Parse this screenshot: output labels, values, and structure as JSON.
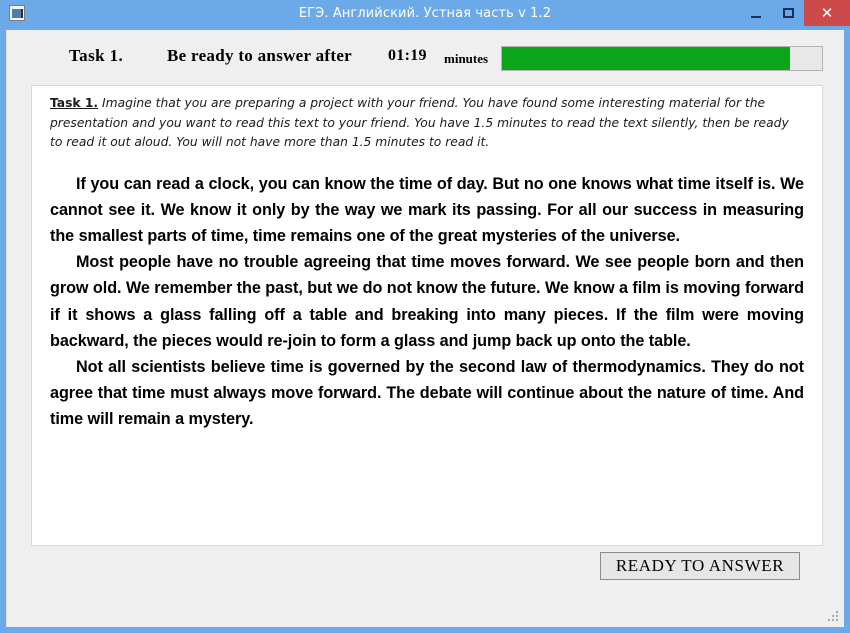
{
  "window": {
    "title": "ЕГЭ. Английский. Устная часть v 1.2",
    "app_icon": "application-window-icon",
    "controls": {
      "minimize": "minimize-icon",
      "maximize": "maximize-icon",
      "close": "✕"
    },
    "frame_color": "#6ca9e8",
    "close_color": "#cc4a49"
  },
  "toolbar": {
    "task_label": "Task 1.",
    "prompt": "Be ready to answer after",
    "timer": "01:19",
    "units": "minutes",
    "progress": {
      "percent": 90,
      "fill_color": "#0ba51c",
      "track_color": "#e8e8e8"
    }
  },
  "document": {
    "instruction_lead": "Task 1.",
    "instruction_body": " Imagine that you are preparing a project with your friend. You have found some interesting material for the presentation and you want to read this text to your friend. You have 1.5 minutes to read the text silently, then be ready to read it out aloud. You will not have more than 1.5 minutes to read it.",
    "paragraphs": [
      "If you can read a clock, you can know the time of day. But no one knows what time itself is. We cannot see it. We know it only by the way we mark its passing. For all our success in measuring the smallest parts of time, time remains one of the great mysteries of the universe.",
      "Most people have no trouble agreeing that time moves forward. We see people born and then grow old. We remember the past, but we do not know the future. We know a film is moving forward if it shows a glass falling off a table and breaking into many pieces. If the film were moving backward, the pieces would re-join to form a glass and jump back up onto the table.",
      "Not all scientists believe time is governed by the second law of thermodynamics. They do not agree that time must always move forward. The debate will continue about the nature of time. And time will remain a mystery."
    ]
  },
  "footer": {
    "ready_button": "READY TO ANSWER",
    "resize_grip": "resize-grip-icon"
  }
}
